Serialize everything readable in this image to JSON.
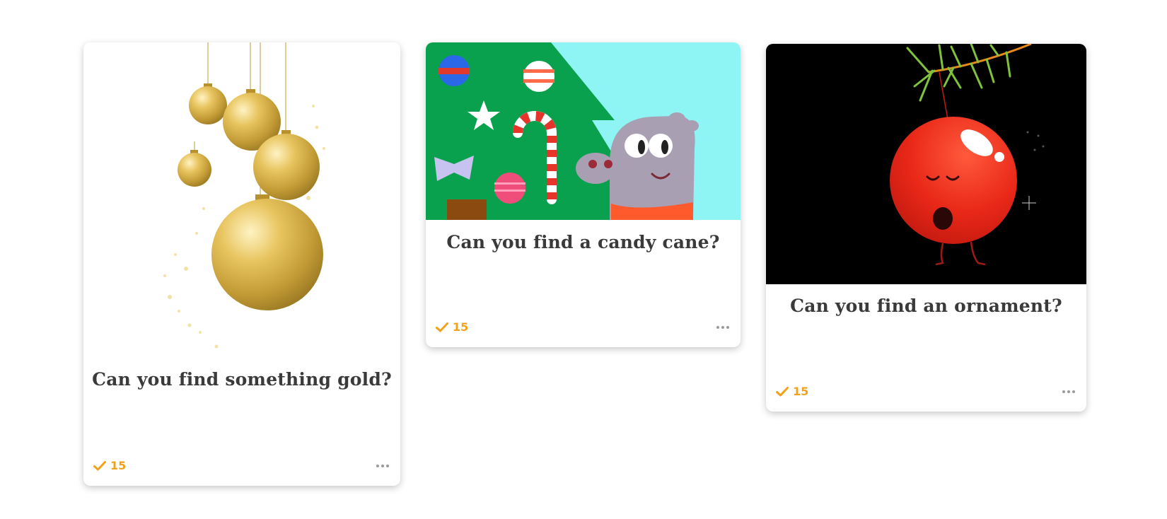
{
  "cards": [
    {
      "title": "Can you find something gold?",
      "image_subject": "gold ornaments",
      "check_count": "15"
    },
    {
      "title": "Can you find a candy cane?",
      "image_subject": "hippo by christmas tree with candy cane",
      "check_count": "15"
    },
    {
      "title": "Can you find an ornament?",
      "image_subject": "singing red ornament",
      "check_count": "15"
    }
  ],
  "colors": {
    "accent": "#f2a11a",
    "title_text": "#3a3a3a",
    "more_dots": "#9a9a9a"
  },
  "icons": {
    "check": "check-icon",
    "more": "more-options-icon"
  }
}
